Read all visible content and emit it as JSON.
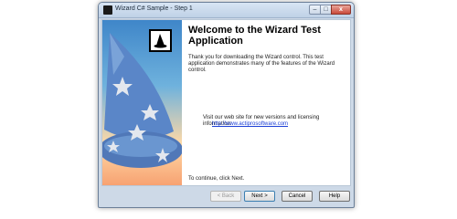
{
  "window": {
    "title": "Wizard C# Sample - Step 1",
    "controls": {
      "minimize": "–",
      "maximize": "□",
      "close": "x"
    }
  },
  "page": {
    "heading": "Welcome to the Wizard Test Application",
    "intro": "Thank you for downloading the Wizard control.  This test application demonstrates many of the features of the Wizard control.",
    "visit_text": "Visit our web site for new versions and licensing information:",
    "link": "http://www.actiprosoftware.com",
    "continue_text": "To continue, click Next."
  },
  "buttons": {
    "back": "< Back",
    "next": "Next >",
    "cancel": "Cancel",
    "help": "Help"
  },
  "colors": {
    "link": "#1c3fd6",
    "hat": "#5a86c8",
    "stars": "#e3e7ee"
  },
  "icons": [
    "app-icon",
    "wizard-hat-image",
    "wizard-logo-icon"
  ]
}
